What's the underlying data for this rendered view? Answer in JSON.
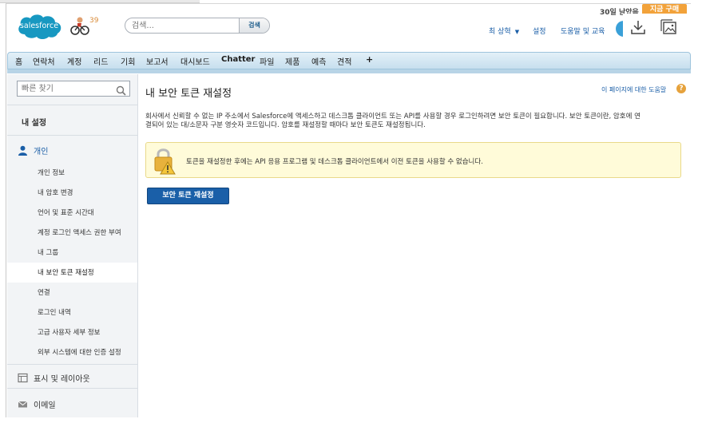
{
  "header": {
    "logo_text": "salesforce",
    "avatar_count": "39",
    "search_placeholder": "검색...",
    "search_button": "검색",
    "trial_text": "30일 남았음",
    "trial_button": "지금 구매",
    "user_menu": "최 상혁",
    "settings": "설정",
    "help": "도움말 및 교육"
  },
  "tabs": [
    "홈",
    "연락처",
    "계정",
    "리드",
    "기회",
    "보고서",
    "대시보드",
    "Chatter",
    "파일",
    "제품",
    "예측",
    "견적",
    "+"
  ],
  "sidebar": {
    "quick_find_placeholder": "빠른 찾기",
    "heading": "내 설정",
    "personal": "개인",
    "items": [
      "개인 정보",
      "내 암호 변경",
      "언어 및 표준 시간대",
      "계정 로그인 액세스 권한 부여",
      "내 그룹",
      "내 보안 토큰 재설정",
      "연결",
      "로그인 내역",
      "고급 사용자 세부 정보",
      "외부 시스템에 대한 인증 설정"
    ],
    "active_index": 5,
    "display_layout": "표시 및 레이아웃",
    "email": "이메일"
  },
  "main": {
    "title": "내 보안 토큰 재설정",
    "help_link": "이 페이지에 대한 도움말",
    "help_badge": "?",
    "description_line1": "회사에서 신뢰할 수 없는 IP 주소에서 Salesforce에 액세스하고 데스크톱 클라이언트 또는 API를 사용할 경우 로그인하려면 보안 토큰이 필요합니다. 보안 토큰이란, 암호에 연",
    "description_line2": "결되어 있는 대/소문자 구분 영숫자 코드입니다. 암호를 재설정할 때마다 보안 토큰도 재설정됩니다.",
    "warning": "토큰을 재설정한 후에는 API 응용 프로그램 및 데스크톱 클라이언트에서 이전 토큰을 사용할 수 없습니다.",
    "reset_button": "보안 토큰 재설정"
  },
  "colors": {
    "brand_blue": "#1a5fa8",
    "link_blue": "#1a5ea7",
    "tab_bg": "#cfe3f0",
    "warning_bg": "#fffbd9",
    "trial_orange": "#f2a23a"
  }
}
